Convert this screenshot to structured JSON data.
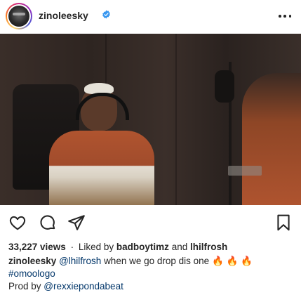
{
  "header": {
    "username": "zinoleesky",
    "verified_icon": "verified-badge-icon",
    "more_icon": "more-options-icon"
  },
  "media": {
    "description_icon": "video-post"
  },
  "actions": {
    "like_icon": "heart-icon",
    "comment_icon": "comment-icon",
    "share_icon": "send-icon",
    "save_icon": "bookmark-icon"
  },
  "stats": {
    "views": "33,227 views",
    "separator": "·",
    "liked_by_prefix": "Liked by",
    "liked_user_1": "badboytimz",
    "and": "and",
    "liked_user_2": "lhilfrosh"
  },
  "caption": {
    "username": "zinoleesky",
    "mention": "@lhilfrosh",
    "text": "when we go drop dis one",
    "emojis": "🔥 🔥 🔥",
    "hashtag": "#omoologo",
    "prod_prefix": "Prod by",
    "prod_mention": "@rexxiepondabeat"
  },
  "colors": {
    "text": "#262626",
    "link": "#003569",
    "verified": "#3897f0"
  }
}
